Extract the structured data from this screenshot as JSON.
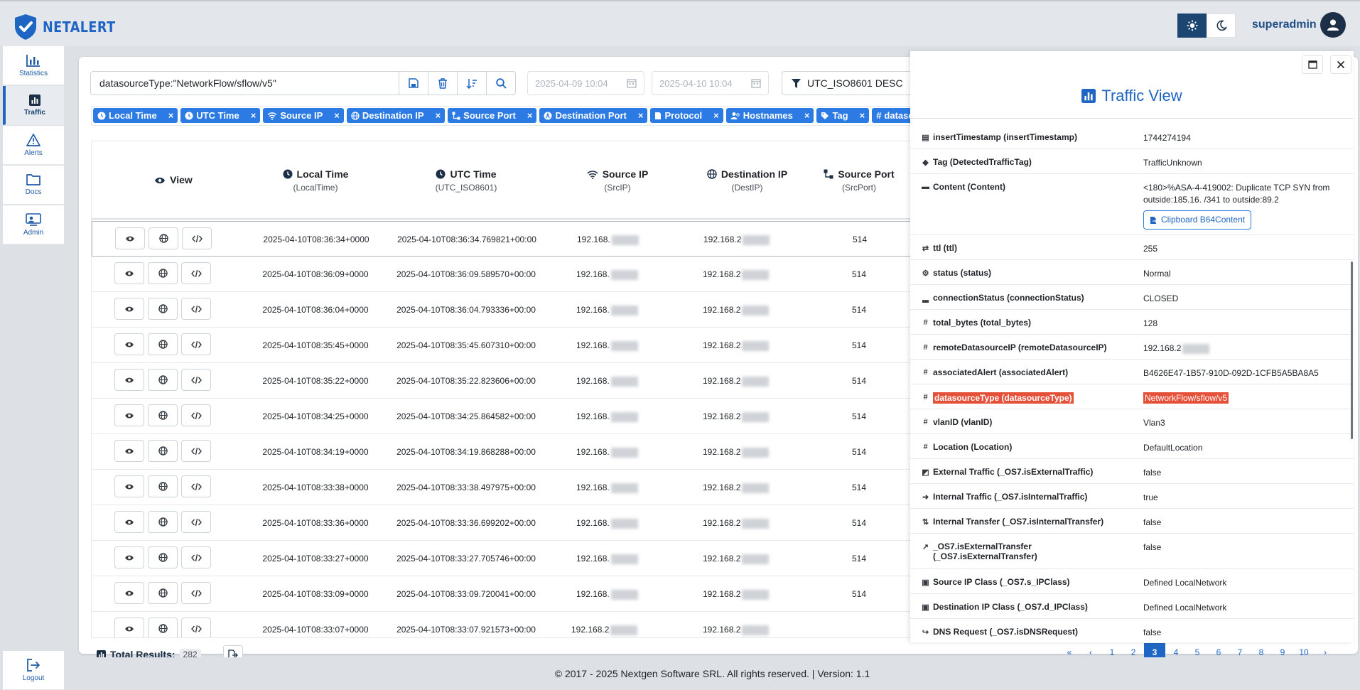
{
  "header": {
    "brand": "NETALERT",
    "user": "superadmin"
  },
  "sidebar": {
    "items": [
      {
        "label": "Statistics",
        "icon": "chart-bar-icon"
      },
      {
        "label": "Traffic",
        "icon": "traffic-chart-icon",
        "active": true
      },
      {
        "label": "Alerts",
        "icon": "warning-triangle-icon"
      },
      {
        "label": "Docs",
        "icon": "folder-icon"
      },
      {
        "label": "Admin",
        "icon": "admin-user-icon"
      }
    ],
    "logout": "Logout"
  },
  "toolbar": {
    "query": "datasourceType:\"NetworkFlow/sflow/v5\"",
    "date_from": "2025-04-09 10:04",
    "date_to": "2025-04-10 10:04",
    "sort": "UTC_ISO8601 DESC"
  },
  "chips": [
    "Local Time",
    "UTC Time",
    "Source IP",
    "Destination IP",
    "Source Port",
    "Destination Port",
    "Protocol",
    "Hostnames",
    "Tag",
    "dataso"
  ],
  "table": {
    "columns": [
      {
        "label": "View",
        "sub": ""
      },
      {
        "label": "Local Time",
        "sub": "(LocalTime)"
      },
      {
        "label": "UTC Time",
        "sub": "(UTC_ISO8601)"
      },
      {
        "label": "Source IP",
        "sub": "(SrcIP)"
      },
      {
        "label": "Destination IP",
        "sub": "(DestIP)"
      },
      {
        "label": "Source Port",
        "sub": "(SrcPort)"
      }
    ],
    "rows": [
      {
        "local": "2025-04-10T08:36:34+0000",
        "utc": "2025-04-10T08:36:34.769821+00:00",
        "src": "192.168.",
        "dst": "192.168.2",
        "port": "514"
      },
      {
        "local": "2025-04-10T08:36:09+0000",
        "utc": "2025-04-10T08:36:09.589570+00:00",
        "src": "192.168.",
        "dst": "192.168.2",
        "port": "514"
      },
      {
        "local": "2025-04-10T08:36:04+0000",
        "utc": "2025-04-10T08:36:04.793336+00:00",
        "src": "192.168.",
        "dst": "192.168.2",
        "port": "514"
      },
      {
        "local": "2025-04-10T08:35:45+0000",
        "utc": "2025-04-10T08:35:45.607310+00:00",
        "src": "192.168.",
        "dst": "192.168.2",
        "port": "514"
      },
      {
        "local": "2025-04-10T08:35:22+0000",
        "utc": "2025-04-10T08:35:22.823606+00:00",
        "src": "192.168.",
        "dst": "192.168.2",
        "port": "514"
      },
      {
        "local": "2025-04-10T08:34:25+0000",
        "utc": "2025-04-10T08:34:25.864582+00:00",
        "src": "192.168.",
        "dst": "192.168.2",
        "port": "514"
      },
      {
        "local": "2025-04-10T08:34:19+0000",
        "utc": "2025-04-10T08:34:19.868288+00:00",
        "src": "192.168.",
        "dst": "192.168.2",
        "port": "514"
      },
      {
        "local": "2025-04-10T08:33:38+0000",
        "utc": "2025-04-10T08:33:38.497975+00:00",
        "src": "192.168.",
        "dst": "192.168.2",
        "port": "514"
      },
      {
        "local": "2025-04-10T08:33:36+0000",
        "utc": "2025-04-10T08:33:36.699202+00:00",
        "src": "192.168.",
        "dst": "192.168.2",
        "port": "514"
      },
      {
        "local": "2025-04-10T08:33:27+0000",
        "utc": "2025-04-10T08:33:27.705746+00:00",
        "src": "192.168.",
        "dst": "192.168.2",
        "port": "514"
      },
      {
        "local": "2025-04-10T08:33:09+0000",
        "utc": "2025-04-10T08:33:09.720041+00:00",
        "src": "192.168.",
        "dst": "192.168.2",
        "port": "514"
      },
      {
        "local": "2025-04-10T08:33:07+0000",
        "utc": "2025-04-10T08:33:07.921573+00:00",
        "src": "192.168.2",
        "dst": "192.168.2",
        "port": ""
      }
    ]
  },
  "total": {
    "label": "Total Results:",
    "count": "282"
  },
  "pagination": {
    "pages": [
      "«",
      "‹",
      "1",
      "2",
      "3",
      "4",
      "5",
      "6",
      "7",
      "8",
      "9",
      "10",
      "›"
    ],
    "current": "3"
  },
  "footer": "© 2017 - 2025 Nextgen Software SRL. All rights reserved. | Version: 1.1",
  "detail": {
    "title": "Traffic View",
    "clipboard_label": "Clipboard B64Content",
    "fields": [
      {
        "icon": "calendar-icon",
        "glyph": "▤",
        "key": "insertTimestamp (insertTimestamp)",
        "value": "1744274194"
      },
      {
        "icon": "tag-icon",
        "glyph": "◆",
        "key": "Tag (DetectedTrafficTag)",
        "value": "TrafficUnknown"
      },
      {
        "icon": "content-icon",
        "glyph": "▬",
        "key": "Content (Content)",
        "value": "<180>%ASA-4-419002: Duplicate TCP SYN from outside:185.16.      /341    to outside:89.2",
        "clip": true
      },
      {
        "icon": "exchange-icon",
        "glyph": "⇄",
        "key": "ttl (ttl)",
        "value": "255"
      },
      {
        "icon": "gear-icon",
        "glyph": "⚙",
        "key": "status (status)",
        "value": "Normal"
      },
      {
        "icon": "signal-icon",
        "glyph": "▂",
        "key": "connectionStatus (connectionStatus)",
        "value": "CLOSED"
      },
      {
        "icon": "hash-icon",
        "glyph": "#",
        "key": "total_bytes (total_bytes)",
        "value": "128"
      },
      {
        "icon": "hash-icon",
        "glyph": "#",
        "key": "remoteDatasourceIP (remoteDatasourceIP)",
        "value": "192.168.2",
        "blur": true
      },
      {
        "icon": "hash-icon",
        "glyph": "#",
        "key": "associatedAlert (associatedAlert)",
        "value": "B4626E47-1B57-910D-092D-1CFB5A5BA8A5"
      },
      {
        "icon": "hash-icon",
        "glyph": "#",
        "key": "datasourceType (datasourceType)",
        "value": "NetworkFlow/sflow/v5",
        "highlight": true
      },
      {
        "icon": "hash-icon",
        "glyph": "#",
        "key": "vlanID (vlanID)",
        "value": "Vlan3"
      },
      {
        "icon": "hash-icon",
        "glyph": "#",
        "key": "Location (Location)",
        "value": "DefaultLocation"
      },
      {
        "icon": "external-square-icon",
        "glyph": "◩",
        "key": "External Traffic (_OS7.isExternalTraffic)",
        "value": "false"
      },
      {
        "icon": "arrow-circle-icon",
        "glyph": "➜",
        "key": "Internal Traffic (_OS7.isInternalTraffic)",
        "value": "true"
      },
      {
        "icon": "hashtag-transfer-icon",
        "glyph": "⇅",
        "key": "Internal Transfer (_OS7.isInternalTransfer)",
        "value": "false"
      },
      {
        "icon": "external-link-icon",
        "glyph": "↗",
        "key": "_OS7.isExternalTransfer (_OS7.isExternalTransfer)",
        "value": "false",
        "tall": true
      },
      {
        "icon": "server-icon",
        "glyph": "▣",
        "key": "Source IP Class (_OS7.s_IPClass)",
        "value": "Defined LocalNetwork"
      },
      {
        "icon": "server-icon",
        "glyph": "▣",
        "key": "Destination IP Class (_OS7.d_IPClass)",
        "value": "Defined LocalNetwork"
      },
      {
        "icon": "share-icon",
        "glyph": "↪",
        "key": "DNS Request (_OS7.isDNSRequest)",
        "value": "false"
      }
    ]
  }
}
